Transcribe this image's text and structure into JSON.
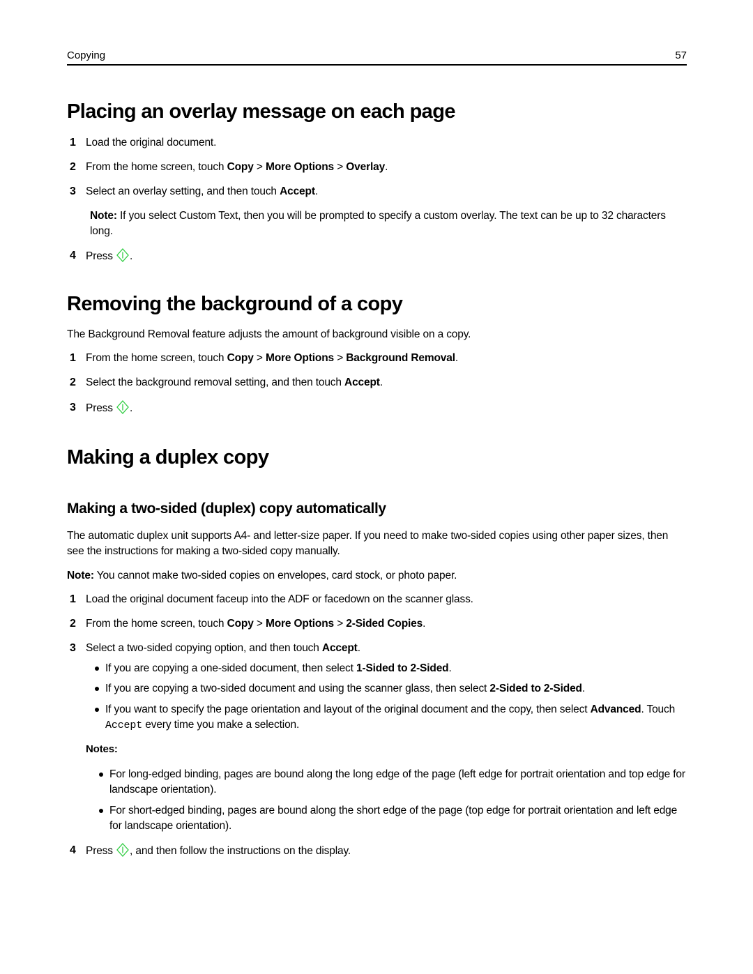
{
  "header": {
    "section": "Copying",
    "page_number": "57"
  },
  "icons": {
    "start": {
      "name": "start-button-icon",
      "color": "#2ecc40"
    }
  },
  "overlay_section": {
    "title": "Placing an overlay message on each page",
    "steps": [
      {
        "num": "1",
        "text": "Load the original document."
      },
      {
        "num": "2",
        "pre": "From the home screen, touch ",
        "b1": "Copy",
        "sep1": " > ",
        "b2": "More Options",
        "sep2": " > ",
        "b3": "Overlay",
        "post": "."
      },
      {
        "num": "3",
        "pre": "Select an overlay setting, and then touch ",
        "b1": "Accept",
        "post": "."
      },
      {
        "num": "4",
        "pre": "Press ",
        "post": "."
      }
    ],
    "note": {
      "label": "Note:",
      "text": " If you select Custom Text, then you will be prompted to specify a custom overlay. The text can be up to 32 characters long."
    }
  },
  "background_section": {
    "title": "Removing the background of a copy",
    "intro": "The Background Removal feature adjusts the amount of background visible on a copy.",
    "steps": [
      {
        "num": "1",
        "pre": "From the home screen, touch ",
        "b1": "Copy",
        "sep1": " > ",
        "b2": "More Options",
        "sep2": " > ",
        "b3": "Background Removal",
        "post": "."
      },
      {
        "num": "2",
        "pre": "Select the background removal setting, and then touch ",
        "b1": "Accept",
        "post": "."
      },
      {
        "num": "3",
        "pre": "Press ",
        "post": "."
      }
    ]
  },
  "duplex_section": {
    "title": "Making a duplex copy",
    "subtitle": "Making a two-sided (duplex) copy automatically",
    "intro": "The automatic duplex unit supports A4- and letter-size paper. If you need to make two-sided copies using other paper sizes, then see the instructions for making a two-sided copy manually.",
    "note": {
      "label": "Note:",
      "text": " You cannot make two-sided copies on envelopes, card stock, or photo paper."
    },
    "steps": [
      {
        "num": "1",
        "text": "Load the original document faceup into the ADF or facedown on the scanner glass."
      },
      {
        "num": "2",
        "pre": "From the home screen, touch ",
        "b1": "Copy",
        "sep1": " > ",
        "b2": "More Options",
        "sep2": " > ",
        "b3": "2-Sided Copies",
        "post": "."
      },
      {
        "num": "3",
        "pre": "Select a two-sided copying option, and then touch ",
        "b1": "Accept",
        "post": "."
      },
      {
        "num": "4",
        "pre": "Press ",
        "post": ", and then follow the instructions on the display."
      }
    ],
    "options": [
      {
        "pre": "If you are copying a one-sided document, then select ",
        "b": "1-Sided to 2-Sided",
        "post": "."
      },
      {
        "pre": "If you are copying a two-sided document and using the scanner glass, then select ",
        "b": "2-Sided to 2-Sided",
        "post": "."
      },
      {
        "pre": "If you want to specify the page orientation and layout of the original document and the copy, then select ",
        "b": "Advanced",
        "mid": ". Touch ",
        "mono": "Accept",
        "post": " every time you make a selection."
      }
    ],
    "notes_label": "Notes:",
    "notes": [
      "For long-edged binding, pages are bound along the long edge of the page (left edge for portrait orientation and top edge for landscape orientation).",
      "For short-edged binding, pages are bound along the short edge of the page (top edge for portrait orientation and left edge for landscape orientation)."
    ]
  }
}
